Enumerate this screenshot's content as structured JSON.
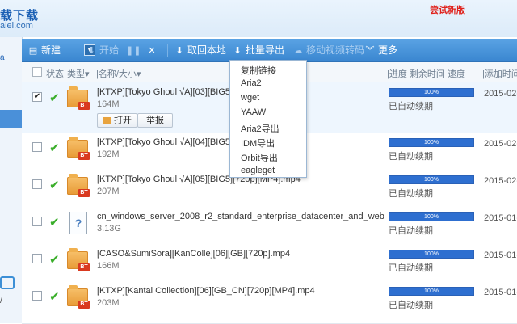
{
  "header": {
    "logo_text": "载下载",
    "logo_sub": "alei.com",
    "new_version": "尝试新版"
  },
  "sidebar": {
    "item_a": "a",
    "bottom_text": "/"
  },
  "toolbar": {
    "new_label": "新建",
    "start_label": "开始",
    "pause_label": "",
    "delete_label": "",
    "fetch_local_label": "取回本地",
    "batch_export_label": "批量导出",
    "move_transcode_label": "移动视频转码",
    "more_label": "更多"
  },
  "columns": {
    "status": "状态",
    "type": "类型",
    "name_size": "|名称/大小",
    "progress_remaining_speed": "|进度 剩余时间 速度",
    "added_time": "|添加时间"
  },
  "export_menu": {
    "items": [
      "复制链接",
      "Aria2",
      "wget",
      "YAAW",
      "Aria2导出",
      "IDM导出",
      "Orbit导出",
      "eagleget"
    ]
  },
  "row_actions": {
    "open_label": "打开",
    "report_label": "举报"
  },
  "tasks": [
    {
      "name": "[KTXP][Tokyo Ghoul √A][03][BIG5][720p][MP4].mp4",
      "size": "164M",
      "progress": "100%",
      "status": "已自动续期",
      "date": "2015-02-",
      "type": "bt-folder",
      "checked": true
    },
    {
      "name": "[KTXP][Tokyo Ghoul √A][04][BIG5][720p][MP4].mp4",
      "size": "192M",
      "progress": "100%",
      "status": "已自动续期",
      "date": "2015-02-",
      "type": "bt-folder",
      "checked": false
    },
    {
      "name": "[KTXP][Tokyo Ghoul √A][05][BIG5][720p][MP4].mp4",
      "size": "207M",
      "progress": "100%",
      "status": "已自动续期",
      "date": "2015-02-",
      "type": "bt-folder",
      "checked": false
    },
    {
      "name": "cn_windows_server_2008_r2_standard_enterprise_datacenter_and_web_w...",
      "size": "3.13G",
      "progress": "100%",
      "status": "已自动续期",
      "date": "2015-01-",
      "type": "unknown",
      "checked": false
    },
    {
      "name": "[CASO&SumiSora][KanColle][06][GB][720p].mp4",
      "size": "166M",
      "progress": "100%",
      "status": "已自动续期",
      "date": "2015-01-",
      "type": "bt-folder",
      "checked": false
    },
    {
      "name": "[KTXP][Kantai Collection][06][GB_CN][720p][MP4].mp4",
      "size": "203M",
      "progress": "100%",
      "status": "已自动续期",
      "date": "2015-01-",
      "type": "bt-folder",
      "checked": false
    }
  ]
}
